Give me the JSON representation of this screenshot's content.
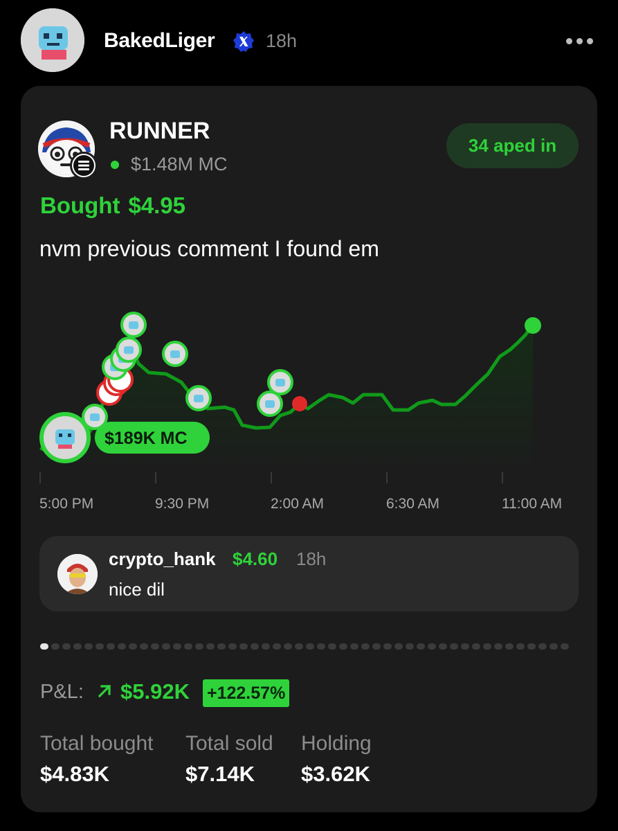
{
  "post": {
    "username": "BakedLiger",
    "time": "18h"
  },
  "token": {
    "name": "RUNNER",
    "market_cap": "$1.48M MC",
    "aped_in": "34 aped in"
  },
  "trade": {
    "bought_label": "Bought",
    "bought_amount": "$4.95",
    "comment": "nvm previous comment I found em"
  },
  "chart_data": {
    "type": "line",
    "x_ticks": [
      "5:00 PM",
      "9:30 PM",
      "2:00 AM",
      "6:30 AM",
      "11:00 AM"
    ],
    "entry_label": "$189K MC",
    "colors": {
      "line": "#109a1a",
      "buy": "#2fd23a",
      "sell": "#e02a2a"
    }
  },
  "reply": {
    "user": "crypto_hank",
    "amount": "$4.60",
    "time": "18h",
    "text": "nice dil"
  },
  "pnl": {
    "label": "P&L:",
    "value": "$5.92K",
    "percent": "+122.57%"
  },
  "stats": [
    {
      "label": "Total bought",
      "value": "$4.83K"
    },
    {
      "label": "Total sold",
      "value": "$7.14K"
    },
    {
      "label": "Holding",
      "value": "$3.62K"
    }
  ],
  "colors": {
    "accent": "#2fd23a",
    "card": "#1c1c1c",
    "verified": "#1d3bd8"
  }
}
